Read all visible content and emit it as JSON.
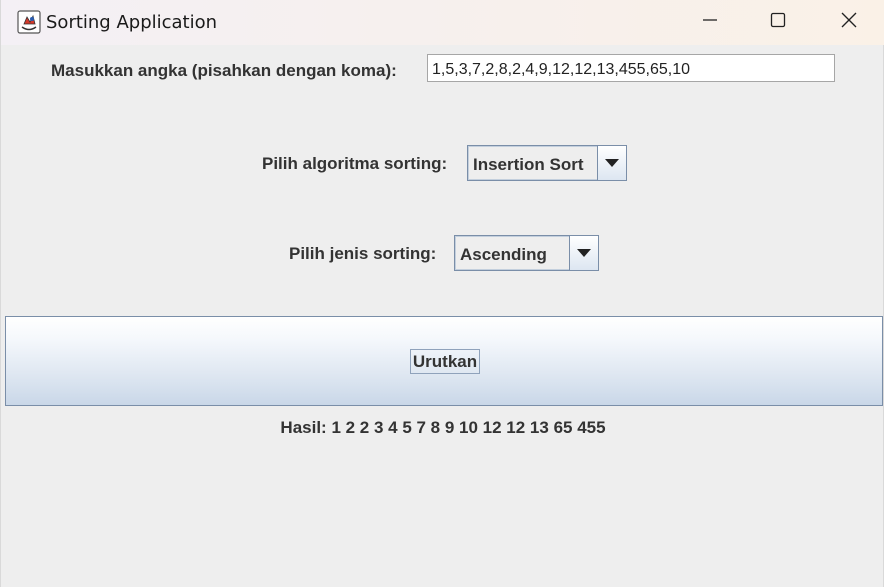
{
  "window": {
    "title": "Sorting Application",
    "app_icon": "java-cup-icon",
    "controls": [
      "minimize-icon",
      "maximize-icon",
      "close-icon"
    ]
  },
  "input_row": {
    "label": "Masukkan angka (pisahkan dengan koma):",
    "value": "1,5,3,7,2,8,2,4,9,12,12,13,455,65,10"
  },
  "algorithm_row": {
    "label": "Pilih algoritma sorting:",
    "selected": "Insertion Sort"
  },
  "order_row": {
    "label": "Pilih jenis sorting:",
    "selected": "Ascending"
  },
  "action": {
    "button_label": "Urutkan"
  },
  "result": {
    "text": "Hasil: 1 2 2 3 4 5 7 8 9 10 12 12 13 65 455"
  },
  "colors": {
    "background": "#eeeeee",
    "border_blue": "#7a8ea8",
    "text": "#333333"
  }
}
